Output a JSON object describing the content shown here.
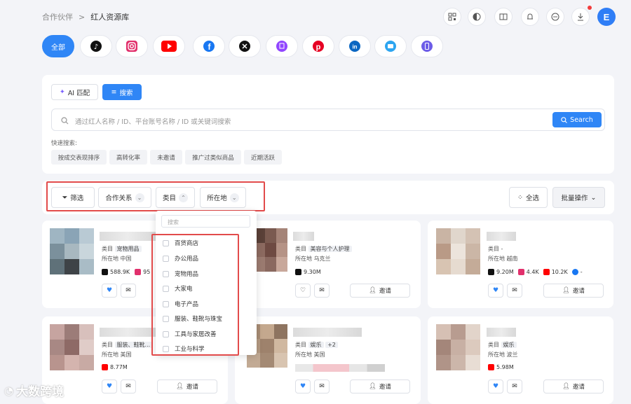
{
  "breadcrumb": {
    "parent": "合作伙伴",
    "sep": ">",
    "current": "红人资源库"
  },
  "user": {
    "initial": "E"
  },
  "platforms": {
    "all": "全部"
  },
  "mode": {
    "ai": "AI 匹配",
    "search": "搜索"
  },
  "search": {
    "placeholder": "通过红人名称 / ID、平台账号名称 / ID 或关键词搜索",
    "button": "Search"
  },
  "quick": {
    "label": "快速搜索:",
    "chips": [
      "按成交表现排序",
      "高转化率",
      "未邀请",
      "推广过类似商品",
      "近期活跃"
    ]
  },
  "filters": {
    "filter": "筛选",
    "relation": "合作关系",
    "category": "类目",
    "location": "所在地",
    "select_all": "全选",
    "batch": "批量操作"
  },
  "dropdown": {
    "placeholder": "搜索",
    "items": [
      "百货商店",
      "办公用品",
      "宠物用品",
      "大家电",
      "电子产品",
      "服装、鞋靴与珠宝",
      "工具与家居改善",
      "工业与科学"
    ]
  },
  "labels": {
    "category": "类目",
    "location": "所在地",
    "invite": "邀请"
  },
  "cards": [
    {
      "cat": "宠物用品",
      "loc": "中国",
      "s1": "588.9K",
      "s2": "95"
    },
    {
      "cat": "美容与个人护理",
      "loc": "乌克兰",
      "s1": "9.30M"
    },
    {
      "cat": "-",
      "loc": "越南",
      "s1": "9.20M",
      "s2": "4.4K",
      "s3": "10.2K",
      "s4": "-"
    },
    {
      "cat": "服装、鞋靴...",
      "loc": "美国",
      "s1": "8.77M"
    },
    {
      "cat": "娱乐",
      "extra": "+2",
      "loc": "美国"
    },
    {
      "cat": "娱乐",
      "loc": "波兰",
      "s1": "5.98M"
    }
  ],
  "watermark": "大数跨境",
  "colors": {
    "accent": "#2f86f6",
    "highlight": "#e24b4b"
  }
}
